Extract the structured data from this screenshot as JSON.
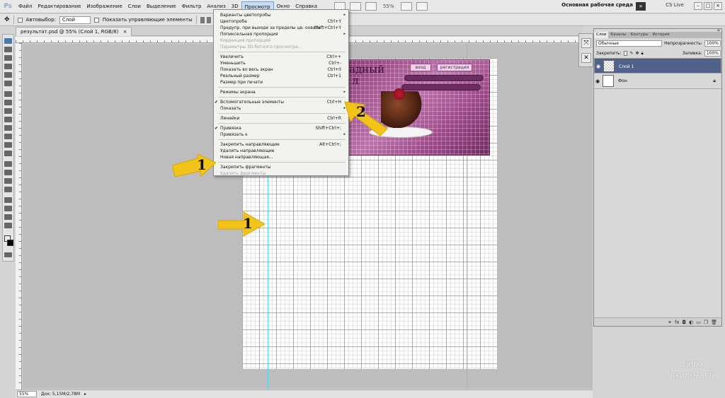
{
  "menubar": {
    "logo": "Ps",
    "items": [
      {
        "label": "Файл"
      },
      {
        "label": "Редактирование"
      },
      {
        "label": "Изображение"
      },
      {
        "label": "Слои"
      },
      {
        "label": "Выделение"
      },
      {
        "label": "Фильтр"
      },
      {
        "label": "Анализ"
      },
      {
        "label": "3D"
      },
      {
        "label": "Просмотр",
        "active": true
      },
      {
        "label": "Окно"
      },
      {
        "label": "Справка"
      }
    ],
    "zoom": "55%",
    "workspace": "Основная рабочая среда",
    "cslive": "CS Live"
  },
  "options": {
    "autoselect_label": "Автовыбор:",
    "autoselect_value": "Слой",
    "show_controls_label": "Показать управляющие элементы"
  },
  "document": {
    "tab_label": "результат.psd @ 55% (Слой 1, RGB/8)",
    "banner_title": "адный",
    "banner_title2": "л",
    "btn_home": "вход",
    "btn_register": "регистрация"
  },
  "status": {
    "zoom": "55%",
    "doc_size": "Док: 5,15M/2,78M"
  },
  "view_menu": {
    "items": [
      {
        "label": "Варианты цветопробы",
        "shortcut": "",
        "submenu": true
      },
      {
        "label": "Цветопроба",
        "shortcut": "Ctrl+Y"
      },
      {
        "label": "Предупр. при выходе за пределы цв. охвата",
        "shortcut": "Shift+Ctrl+Y"
      },
      {
        "label": "Попиксельная пропорция",
        "shortcut": "",
        "submenu": true
      },
      {
        "label": "Коррекция пропорций",
        "shortcut": "",
        "disabled": true
      },
      {
        "label": "Параметры 3D-битного просмотра...",
        "shortcut": "",
        "disabled": true
      },
      {
        "label": "Увеличить",
        "shortcut": "Ctrl++"
      },
      {
        "label": "Уменьшить",
        "shortcut": "Ctrl+-"
      },
      {
        "label": "Показать во весь экран",
        "shortcut": "Ctrl+0"
      },
      {
        "label": "Реальный размер",
        "shortcut": "Ctrl+1"
      },
      {
        "label": "Размер при печати",
        "shortcut": ""
      },
      {
        "label": "Режимы экрана",
        "shortcut": "",
        "submenu": true
      },
      {
        "label": "Вспомогательные элементы",
        "shortcut": "Ctrl+H",
        "checked": true
      },
      {
        "label": "Показать",
        "shortcut": "",
        "submenu": true
      },
      {
        "label": "Линейки",
        "shortcut": "Ctrl+R"
      },
      {
        "label": "Привязка",
        "shortcut": "Shift+Ctrl+;",
        "checked": true
      },
      {
        "label": "Привязать к",
        "shortcut": "",
        "submenu": true
      },
      {
        "label": "Закрепить направляющие",
        "shortcut": "Alt+Ctrl+;"
      },
      {
        "label": "Удалить направляющие",
        "shortcut": ""
      },
      {
        "label": "Новая направляющая...",
        "shortcut": ""
      },
      {
        "label": "Закрепить фрагменты",
        "shortcut": ""
      },
      {
        "label": "Удалить фрагменты",
        "shortcut": "",
        "disabled": true
      }
    ]
  },
  "layers_panel": {
    "tabs": [
      "Слои",
      "Каналы",
      "Контуры",
      "История"
    ],
    "blend_mode": "Обычные",
    "opacity_label": "Непрозрачность:",
    "opacity_value": "100%",
    "lock_label": "Закрепить:",
    "fill_label": "Заливка:",
    "fill_value": "100%",
    "layers": [
      {
        "name": "Слой 1",
        "selected": true
      },
      {
        "name": "Фон",
        "locked": true
      }
    ]
  },
  "annotations": {
    "arrow1_upper": "1",
    "arrow1_lower": "1",
    "arrow2": "2"
  },
  "watermark": {
    "line1": "Foto",
    "line2": "komok.ru"
  },
  "colors": {
    "accent_selected_layer": "#50628a",
    "guide": "#58d4e8",
    "arrow_fill": "#f2c318"
  }
}
